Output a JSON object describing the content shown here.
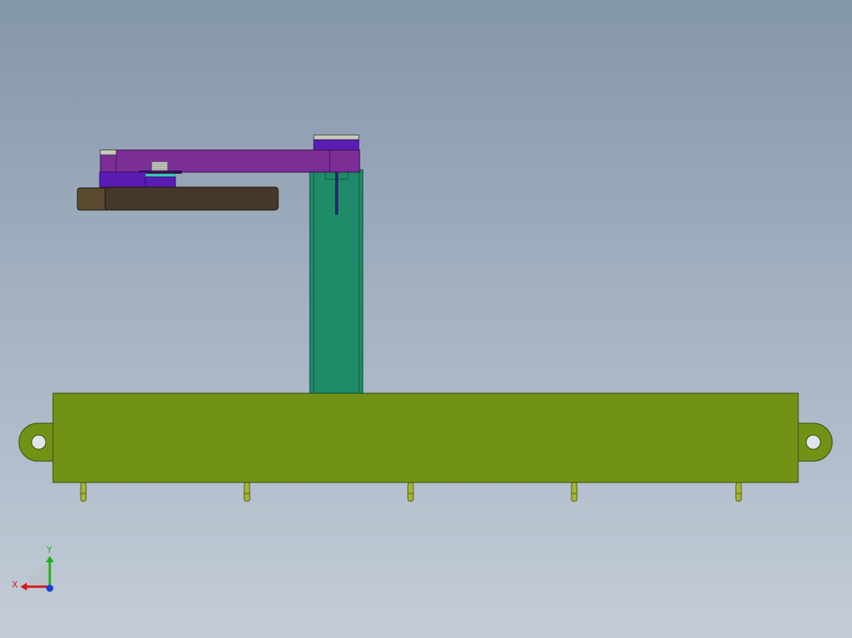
{
  "viewport": {
    "background_top": "#8496aa",
    "background_bottom": "#c4ccd8"
  },
  "colors": {
    "base_beam": "#729215",
    "column": "#1f8b69",
    "upper_arm": "#7b2e96",
    "joint_block": "#5a1cb2",
    "end_effector": "#43382a",
    "pins": "#a6b432"
  },
  "triad": {
    "x_label": "X",
    "y_label": "Y",
    "x_color": "#d01a1a",
    "y_color": "#18b418",
    "z_color": "#1a3fd0"
  }
}
